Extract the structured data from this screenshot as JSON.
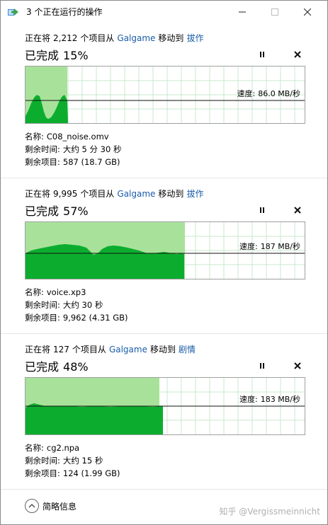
{
  "window": {
    "title": "3 个正在运行的操作",
    "less_details_label": "简略信息",
    "watermark": "知乎 @Vergissmeinnicht"
  },
  "operations": [
    {
      "prefix": "正在将",
      "count": "2,212",
      "mid": "个项目从",
      "source": "Galgame",
      "verb": "移动到",
      "destination": "拔作",
      "status_label": "已完成",
      "percent": "15%",
      "progress": 0.15,
      "speed_label": "速度:",
      "speed": "86.0 MB/秒",
      "name_label": "名称:",
      "name": "C08_noise.omv",
      "time_label": "剩余时间:",
      "time": "大约 5 分 30 秒",
      "items_label": "剩余项目:",
      "items": "587 (18.7 GB)"
    },
    {
      "prefix": "正在将",
      "count": "9,995",
      "mid": "个项目从",
      "source": "Galgame",
      "verb": "移动到",
      "destination": "拔作",
      "status_label": "已完成",
      "percent": "57%",
      "progress": 0.57,
      "speed_label": "速度:",
      "speed": "187 MB/秒",
      "name_label": "名称:",
      "name": "voice.xp3",
      "time_label": "剩余时间:",
      "time": "大约 30 秒",
      "items_label": "剩余项目:",
      "items": "9,962 (4.31 GB)"
    },
    {
      "prefix": "正在将",
      "count": "127",
      "mid": "个项目从",
      "source": "Galgame",
      "verb": "移动到",
      "destination": "剧情",
      "status_label": "已完成",
      "percent": "48%",
      "progress": 0.48,
      "speed_label": "速度:",
      "speed": "183 MB/秒",
      "name_label": "名称:",
      "name": "cg2.npa",
      "time_label": "剩余时间:",
      "time": "大约 15 秒",
      "items_label": "剩余项目:",
      "items": "124 (1.99 GB)"
    }
  ],
  "colors": {
    "progress_fill": "#a8e29a",
    "speed_fill": "#0cad2e",
    "grid_line": "#c8e8cc",
    "link": "#1a5ca8"
  },
  "icons": {
    "pause": "pause-icon",
    "stop": "close-icon",
    "collapse": "chevron-up-icon"
  }
}
